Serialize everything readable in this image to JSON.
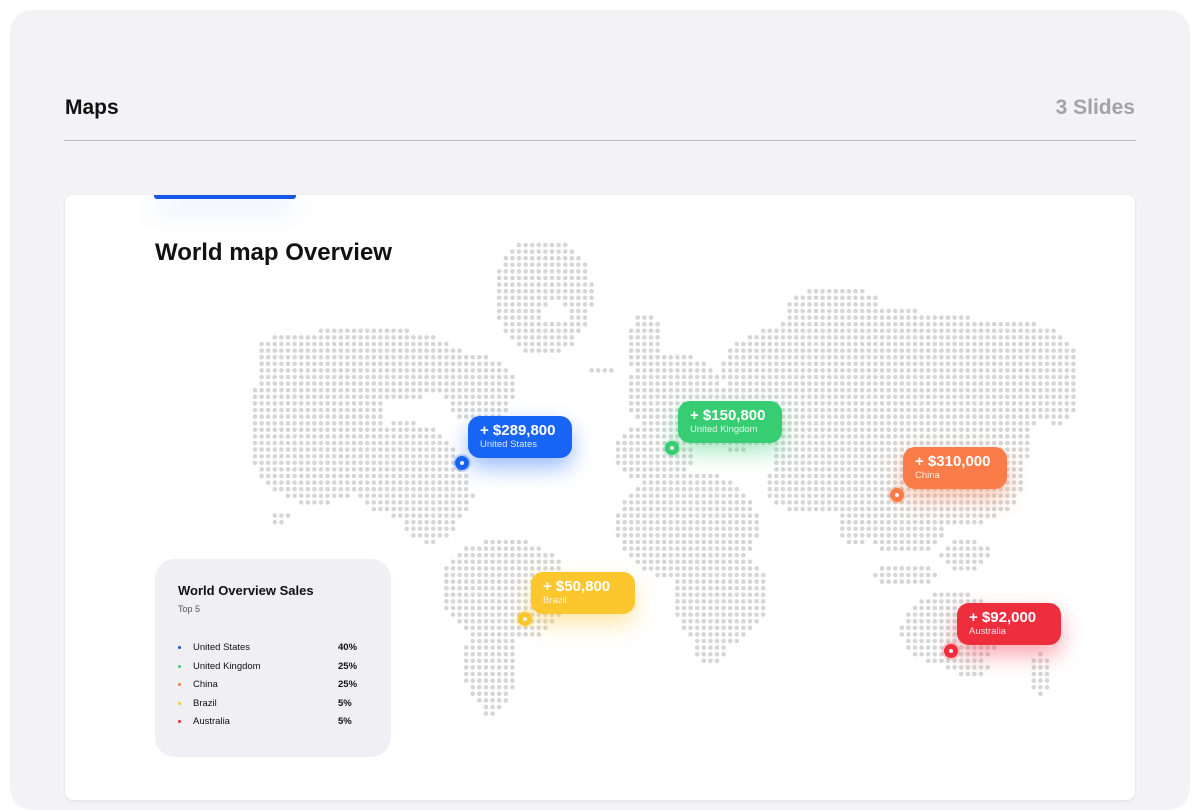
{
  "header": {
    "title": "Maps",
    "slide_count": "3 Slides"
  },
  "card": {
    "title": "World map Overview"
  },
  "colors": {
    "accent": "#1557e6",
    "blue": "#1864f5",
    "green": "#37cd73",
    "orange": "#fb7c48",
    "yellow": "#fcc62f",
    "red": "#ef2e3d",
    "map_dot": "#d6d6d6"
  },
  "callouts": [
    {
      "amount": "+ $289,800",
      "country": "United States",
      "color": "#1864f5"
    },
    {
      "amount": "+ $150,800",
      "country": "United Kingdom",
      "color": "#37cd73"
    },
    {
      "amount": "+ $310,000",
      "country": "China",
      "color": "#fb7c48"
    },
    {
      "amount": "+ $50,800",
      "country": "Brazil",
      "color": "#fcc62f"
    },
    {
      "amount": "+ $92,000",
      "country": "Australia",
      "color": "#ef2e3d"
    }
  ],
  "legend": {
    "title": "World Overview Sales",
    "subtitle": "Top 5",
    "items": [
      {
        "name": "United States",
        "percent": "40%",
        "color": "#1557e6"
      },
      {
        "name": "United Kingdom",
        "percent": "25%",
        "color": "#37cd73"
      },
      {
        "name": "China",
        "percent": "25%",
        "color": "#fb7c48"
      },
      {
        "name": "Brazil",
        "percent": "5%",
        "color": "#fcc62f"
      },
      {
        "name": "Australia",
        "percent": "5%",
        "color": "#ef2e3d"
      }
    ]
  }
}
